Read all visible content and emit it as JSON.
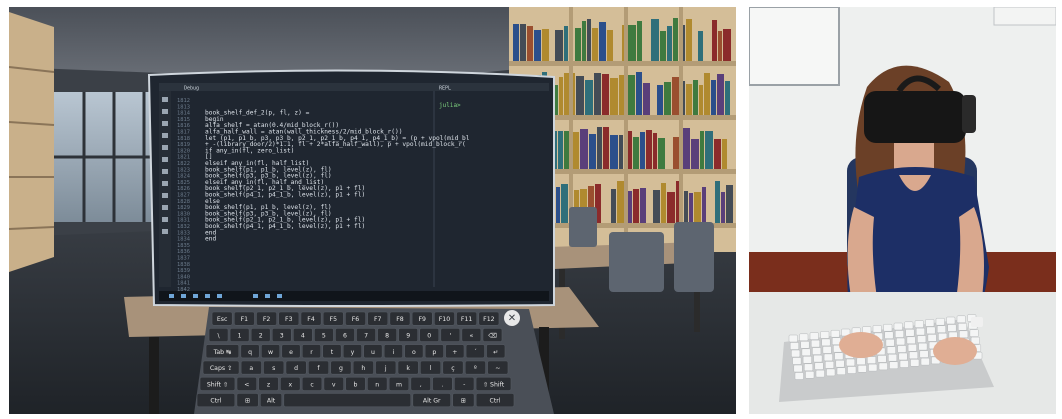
{
  "vr_scene": {
    "editor": {
      "tab_title": "Debug",
      "right_title": "REPL",
      "repl_prompt": "julia>",
      "line_numbers": [
        "1812",
        "1813",
        "1814",
        "1815",
        "1816",
        "1817",
        "1818",
        "1819",
        "1820",
        "1821",
        "1822",
        "1823",
        "1824",
        "1825",
        "1826",
        "1827",
        "1828",
        "1829",
        "1830",
        "1831",
        "1832",
        "1833",
        "1834",
        "1835",
        "1836",
        "1837",
        "1838",
        "1839",
        "1840",
        "1841",
        "1842"
      ],
      "code_lines": [
        "book_shelf_def_2(p, fl, z) =",
        "  begin",
        "    alfa_shelf = atan(0.4/mid_block_r())",
        "    alfa_half_wall = atan(wall_thickness/2/mid_block_r())",
        "    let (p1, p1_b, p3, p3_b, p2_1, p2_1_b, p4_1, p4_1_b) = (p + vpol(mid_bl",
        "      + -(library_door/2)*1.1, fl + 2*alfa_half_wall), p + vpol(mid_block_r(",
        "      if any_in(fl, zero_list)",
        "        []",
        "      elseif any_in(fl, half_list)",
        "        book_shelf(p1, p1_b, level(z), fl)",
        "        book_shelf(p3, p3_b, level(z), fl)",
        "      elseif any_in(fl, half_and_list)",
        "        book_shelf(p2_1, p2_1_b, level(z), p1 + fl)",
        "        book_shelf(p4_1, p4_1_b, level(z), p1 + fl)",
        "      else",
        "        book_shelf(p1, p1_b, level(z), fl)",
        "        book_shelf(p3, p3_b, level(z), fl)",
        "        book_shelf(p2_1, p2_1_b, level(z), p1 + fl)",
        "        book_shelf(p4_1, p4_1_b, level(z), p1 + fl)",
        "      end",
        "    end"
      ]
    },
    "keyboard": {
      "rows": [
        [
          "Esc",
          "F1",
          "F2",
          "F3",
          "F4",
          "F5",
          "F6",
          "F7",
          "F8",
          "F9",
          "F10",
          "F11",
          "F12"
        ],
        [
          "\\",
          "1",
          "2",
          "3",
          "4",
          "5",
          "6",
          "7",
          "8",
          "9",
          "0",
          "'",
          "«",
          "⌫"
        ],
        [
          "Tab ↹",
          "q",
          "w",
          "e",
          "r",
          "t",
          "y",
          "u",
          "i",
          "o",
          "p",
          "+",
          "´",
          "↵"
        ],
        [
          "Caps ⇪",
          "a",
          "s",
          "d",
          "f",
          "g",
          "h",
          "j",
          "k",
          "l",
          "ç",
          "º",
          "~"
        ],
        [
          "Shift ⇧",
          "<",
          "z",
          "x",
          "c",
          "v",
          "b",
          "n",
          "m",
          ",",
          ".",
          "-",
          "⇧ Shift"
        ],
        [
          "Ctrl",
          "⊞",
          "Alt",
          "",
          "Alt Gr",
          "⊞",
          "Ctrl"
        ]
      ],
      "close_glyph": "✕"
    }
  },
  "photo": {
    "description_icons": [
      "vr-headset",
      "keyboard"
    ]
  }
}
